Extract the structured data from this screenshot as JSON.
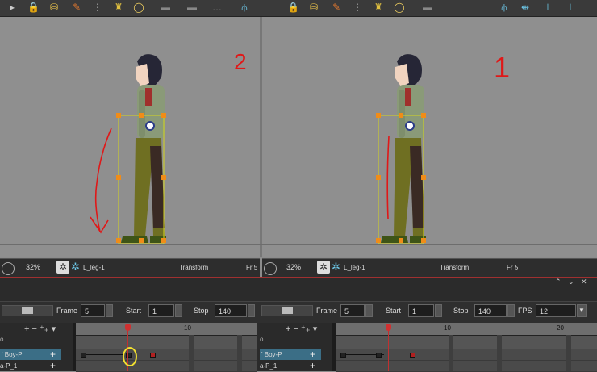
{
  "toolbar": {
    "icons": [
      "play-icon",
      "lock-icon",
      "lock-plus-icon",
      "pen-icon",
      "onion-skin-icon",
      "stamp-icon",
      "egg-icon",
      "disc-icon",
      "disc-icon",
      "ellipsis-icon",
      "align-tree-icon",
      "lock-icon",
      "lock-plus-icon",
      "pen-icon",
      "onion-skin-icon",
      "stamp-icon",
      "egg-icon",
      "disc-icon",
      "align-tree-icon",
      "align-spread-icon",
      "align-add-icon",
      "align-add-icon"
    ]
  },
  "viewports": [
    {
      "annotation": "2",
      "status": {
        "zoom": "32%",
        "layer": "L_leg-1",
        "mode": "Transform",
        "frame_label": "Fr 5"
      }
    },
    {
      "annotation": "1",
      "status": {
        "zoom": "32%",
        "layer": "L_leg-1",
        "mode": "Transform",
        "frame_label": "Fr 5"
      }
    }
  ],
  "timeline_left": {
    "frame_label": "Frame",
    "frame_value": "5",
    "start_label": "Start",
    "start_value": "1",
    "stop_label": "Stop",
    "stop_value": "140",
    "ruler_numbers": [
      "10"
    ],
    "layers": [
      {
        "name": "Boy-P",
        "selected": true
      },
      {
        "name": "a-P_1",
        "selected": false
      }
    ]
  },
  "timeline_right": {
    "frame_label": "Frame",
    "frame_value": "5",
    "start_label": "Start",
    "start_value": "1",
    "stop_label": "Stop",
    "stop_value": "140",
    "fps_label": "FPS",
    "fps_value": "12",
    "ruler_numbers": [
      "10",
      "20"
    ],
    "layers": [
      {
        "name": "Boy-P",
        "selected": true
      },
      {
        "name": "a-P_1",
        "selected": false
      }
    ]
  },
  "colors": {
    "annotation": "#e01818",
    "bbox": "#d6d61e",
    "handle": "#f08c18",
    "selected_row": "#3b6e86",
    "playhead": "#d03030"
  }
}
